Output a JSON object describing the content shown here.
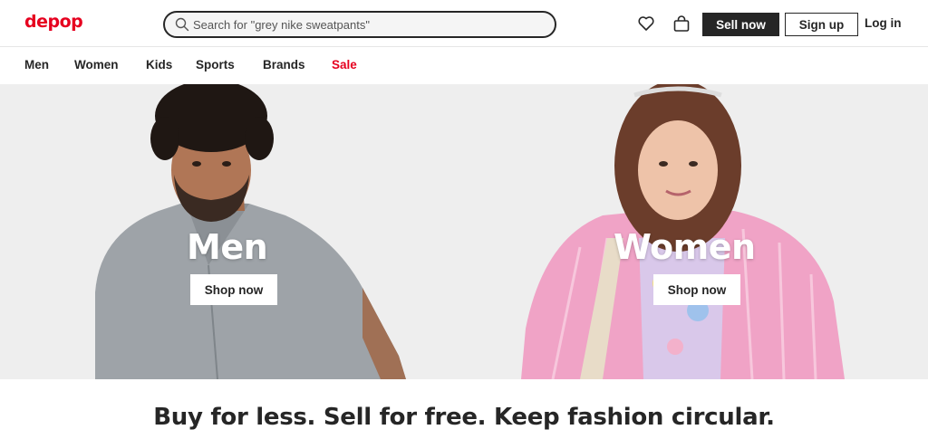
{
  "brand": {
    "logo_text": "depop",
    "color": "#e6001f"
  },
  "search": {
    "value": "Search for \"grey nike sweatpants\"",
    "icon": "search-icon"
  },
  "header": {
    "icons": [
      "heart-icon",
      "shopping-bag-icon"
    ],
    "sell_label": "Sell now",
    "signup_label": "Sign up",
    "login_label": "Log in"
  },
  "nav": {
    "items": [
      {
        "label": "Men"
      },
      {
        "label": "Women"
      },
      {
        "label": "Kids"
      },
      {
        "label": "Sports"
      },
      {
        "label": "Brands"
      },
      {
        "label": "Sale"
      }
    ],
    "sale_color": "#e6001f"
  },
  "hero": {
    "left": {
      "title": "Men",
      "button": "Shop now"
    },
    "right": {
      "title": "Women",
      "button": "Shop now"
    }
  },
  "tagline": "Buy for less. Sell for free. Keep fashion circular."
}
